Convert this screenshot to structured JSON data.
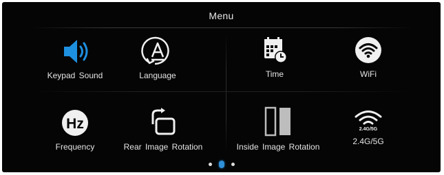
{
  "menu": {
    "title": "Menu",
    "items": [
      {
        "label": "Keypad  Sound",
        "icon": "speaker-icon",
        "color": "#1e90e0"
      },
      {
        "label": "Language",
        "icon": "language-icon"
      },
      {
        "label": "Time",
        "icon": "calendar-clock-icon"
      },
      {
        "label": "WiFi",
        "icon": "wifi-icon"
      },
      {
        "label": "Frequency",
        "icon": "hz-icon",
        "icon_text": "Hz"
      },
      {
        "label": "Rear  Image  Rotation",
        "icon": "rotate-icon"
      },
      {
        "label": "Inside  Image  Rotation",
        "icon": "mirror-panels-icon"
      },
      {
        "label": "2.4G/5G",
        "icon": "wifi-band-icon",
        "icon_text": "2.4G/5G"
      }
    ]
  },
  "pagination": {
    "pages": 3,
    "current": 2
  },
  "colors": {
    "background": "#050505",
    "accent": "#2f8fd8",
    "text": "#e4e4e4"
  }
}
